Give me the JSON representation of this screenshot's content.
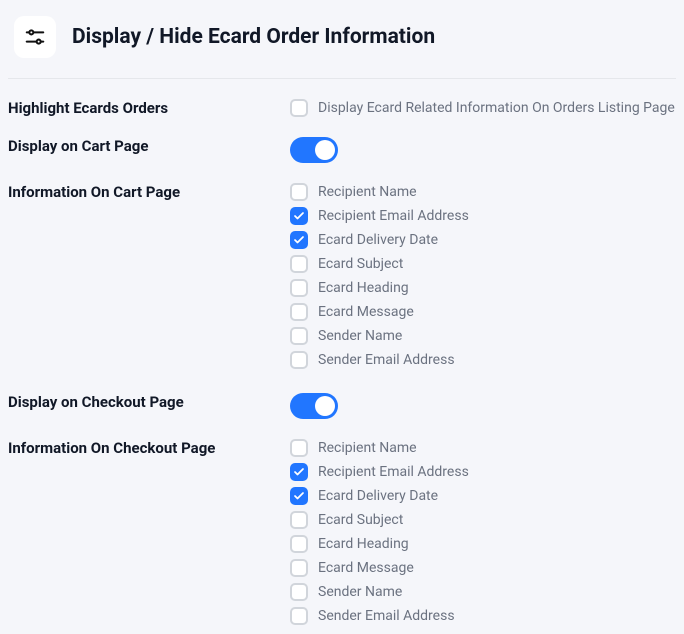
{
  "header": {
    "title": "Display / Hide Ecard Order Information"
  },
  "rows": {
    "highlight": {
      "label": "Highlight Ecards Orders",
      "option_label": "Display Ecard Related Information On Orders Listing Page",
      "checked": false
    },
    "display_cart": {
      "label": "Display on Cart Page",
      "toggle": true
    },
    "info_cart": {
      "label": "Information On Cart Page",
      "options": [
        {
          "label": "Recipient Name",
          "checked": false
        },
        {
          "label": "Recipient Email Address",
          "checked": true
        },
        {
          "label": "Ecard Delivery Date",
          "checked": true
        },
        {
          "label": "Ecard Subject",
          "checked": false
        },
        {
          "label": "Ecard Heading",
          "checked": false
        },
        {
          "label": "Ecard Message",
          "checked": false
        },
        {
          "label": "Sender Name",
          "checked": false
        },
        {
          "label": "Sender Email Address",
          "checked": false
        }
      ]
    },
    "display_checkout": {
      "label": "Display on Checkout Page",
      "toggle": true
    },
    "info_checkout": {
      "label": "Information On Checkout Page",
      "options": [
        {
          "label": "Recipient Name",
          "checked": false
        },
        {
          "label": "Recipient Email Address",
          "checked": true
        },
        {
          "label": "Ecard Delivery Date",
          "checked": true
        },
        {
          "label": "Ecard Subject",
          "checked": false
        },
        {
          "label": "Ecard Heading",
          "checked": false
        },
        {
          "label": "Ecard Message",
          "checked": false
        },
        {
          "label": "Sender Name",
          "checked": false
        },
        {
          "label": "Sender Email Address",
          "checked": false
        }
      ]
    }
  }
}
